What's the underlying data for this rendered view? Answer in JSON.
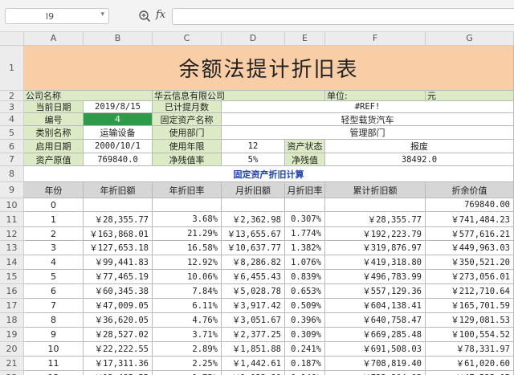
{
  "namebox": {
    "value": "I9"
  },
  "formula_bar": {
    "fx_label": "fx",
    "value": ""
  },
  "columns": [
    "A",
    "B",
    "C",
    "D",
    "E",
    "F",
    "G"
  ],
  "row_numbers": [
    "1",
    "2",
    "3",
    "4",
    "5",
    "6",
    "7",
    "8",
    "9",
    "10",
    "11",
    "12",
    "13",
    "14",
    "15",
    "16",
    "17",
    "18",
    "19",
    "20",
    "21",
    "22"
  ],
  "title": "余额法提计折旧表",
  "company": {
    "label": "公司名称",
    "name": "华云信息有限公司",
    "unit_label": "单位:",
    "unit": "元"
  },
  "info": {
    "current_date_label": "当前日期",
    "current_date": "2019/8/15",
    "months_label": "已计提月数",
    "months": "#REF!",
    "id_label": "编号",
    "id": "4",
    "asset_name_label": "固定资产名称",
    "asset_name": "轻型载货汽车",
    "category_label": "类别名称",
    "category": "运输设备",
    "dept_label": "使用部门",
    "dept": "管理部门",
    "start_label": "启用日期",
    "start": "2000/10/1",
    "life_label": "使用年限",
    "life": "12",
    "status_label": "资产状态",
    "status": "报废",
    "original_label": "资产原值",
    "original": "769840.0",
    "residual_rate_label": "净残值率",
    "residual_rate": "5%",
    "residual_label": "净残值",
    "residual": "38492.0"
  },
  "section_title": "固定资产折旧计算",
  "table_headers": [
    "年份",
    "年折旧额",
    "年折旧率",
    "月折旧额",
    "月折旧率",
    "累计折旧额",
    "折余价值"
  ],
  "rows": [
    [
      "0",
      "",
      "",
      "",
      "",
      "",
      "769840.00"
    ],
    [
      "1",
      "￥28,355.77",
      "3.68%",
      "￥2,362.98",
      "0.307%",
      "￥28,355.77",
      "￥741,484.23"
    ],
    [
      "2",
      "￥163,868.01",
      "21.29%",
      "￥13,655.67",
      "1.774%",
      "￥192,223.79",
      "￥577,616.21"
    ],
    [
      "3",
      "￥127,653.18",
      "16.58%",
      "￥10,637.77",
      "1.382%",
      "￥319,876.97",
      "￥449,963.03"
    ],
    [
      "4",
      "￥99,441.83",
      "12.92%",
      "￥8,286.82",
      "1.076%",
      "￥419,318.80",
      "￥350,521.20"
    ],
    [
      "5",
      "￥77,465.19",
      "10.06%",
      "￥6,455.43",
      "0.839%",
      "￥496,783.99",
      "￥273,056.01"
    ],
    [
      "6",
      "￥60,345.38",
      "7.84%",
      "￥5,028.78",
      "0.653%",
      "￥557,129.36",
      "￥212,710.64"
    ],
    [
      "7",
      "￥47,009.05",
      "6.11%",
      "￥3,917.42",
      "0.509%",
      "￥604,138.41",
      "￥165,701.59"
    ],
    [
      "8",
      "￥36,620.05",
      "4.76%",
      "￥3,051.67",
      "0.396%",
      "￥640,758.47",
      "￥129,081.53"
    ],
    [
      "9",
      "￥28,527.02",
      "3.71%",
      "￥2,377.25",
      "0.309%",
      "￥669,285.48",
      "￥100,554.52"
    ],
    [
      "10",
      "￥22,222.55",
      "2.89%",
      "￥1,851.88",
      "0.241%",
      "￥691,508.03",
      "￥78,331.97"
    ],
    [
      "11",
      "￥17,311.36",
      "2.25%",
      "￥1,442.61",
      "0.187%",
      "￥708,819.40",
      "￥61,020.60"
    ],
    [
      "12",
      "￥13,485.55",
      "1.75%",
      "￥1,123.80",
      "0.146%",
      "￥722,304.95",
      "￥47,535.05"
    ]
  ]
}
